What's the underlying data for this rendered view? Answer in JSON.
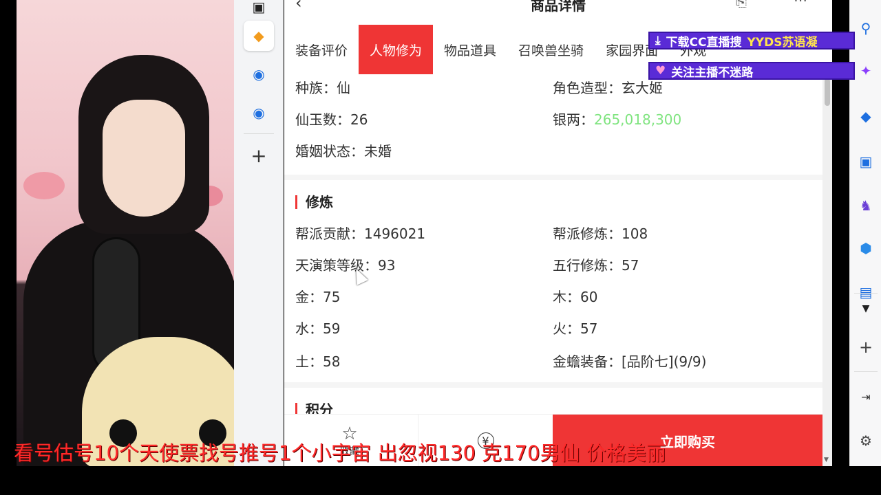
{
  "page": {
    "header_title": "商品详情",
    "tabs": [
      "装备评价",
      "人物修为",
      "物品道具",
      "召唤兽坐骑",
      "家园界面",
      "外观"
    ],
    "active_tab_index": 1
  },
  "basic_info": {
    "race_label": "种族：",
    "race_value": "仙",
    "model_label": "角色造型：",
    "model_value": "玄大姬",
    "jade_label": "仙玉数：",
    "jade_value": "26",
    "silver_label": "银两：",
    "silver_value": "265,018,300",
    "marriage_label": "婚姻状态：",
    "marriage_value": "未婚"
  },
  "cultivation": {
    "title": "修炼",
    "guild_contrib_label": "帮派贡献：",
    "guild_contrib_value": "1496021",
    "guild_train_label": "帮派修炼：",
    "guild_train_value": "108",
    "tianyan_label": "天演策等级：",
    "tianyan_value": "93",
    "wuxing_label": "五行修炼：",
    "wuxing_value": "57",
    "metal_label": "金：",
    "metal_value": "75",
    "wood_label": "木：",
    "wood_value": "60",
    "water_label": "水：",
    "water_value": "59",
    "fire_label": "火：",
    "fire_value": "57",
    "earth_label": "土：",
    "earth_value": "58",
    "toad_label": "金蟾装备：",
    "toad_value": "[品阶七](9/9)"
  },
  "next_section": {
    "title": "积分"
  },
  "bottom_bar": {
    "favorite_label": "收藏",
    "price_icon": "¥",
    "buy_label": "立即购买"
  },
  "overlays": {
    "banner1_text": "下载CC直播搜",
    "banner1_highlight": "YYDS苏语凝",
    "banner2_text": "关注主播不迷路",
    "ticker": "看号估号10个天使票找号推号1个小宇宙 出忽视130  克170男仙 价格美丽"
  },
  "colors": {
    "accent": "#ef3535",
    "silver_value": "#7fe47f",
    "banner": "#5a2bd6"
  }
}
